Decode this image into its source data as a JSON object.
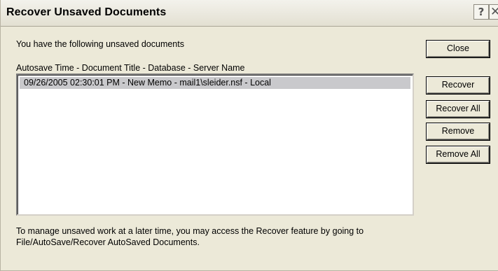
{
  "window": {
    "title": "Recover Unsaved Documents",
    "help_label": "?",
    "close_label": "✕"
  },
  "main": {
    "intro_text": "You have the following unsaved documents",
    "column_header": "Autosave Time - Document Title - Database - Server Name",
    "documents": [
      {
        "text": "09/26/2005 02:30:01 PM - New Memo - mail1\\sleider.nsf - Local",
        "selected": true
      }
    ]
  },
  "buttons": {
    "close": "Close",
    "recover": "Recover",
    "recover_all": "Recover All",
    "remove": "Remove",
    "remove_all": "Remove All"
  },
  "footer": {
    "line1": "To manage unsaved work at a later time, you may access the Recover feature by going to",
    "line2": "File/AutoSave/Recover AutoSaved Documents."
  },
  "colors": {
    "dialog_background": "#ece9d8",
    "selection": "#c9c9cc"
  },
  "icons": {
    "help": "question-mark-icon",
    "close": "close-icon"
  }
}
